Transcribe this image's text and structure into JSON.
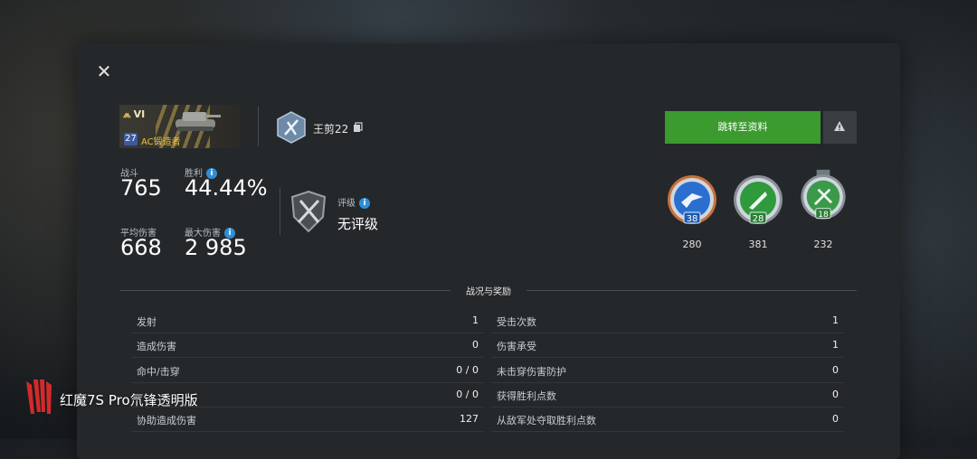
{
  "vehicle": {
    "tier": "VI",
    "level": "27",
    "name": "AC锻造者"
  },
  "player": {
    "name": "王剪22"
  },
  "stats": {
    "battles_label": "战斗",
    "battles_value": "765",
    "win_label": "胜利",
    "win_value": "44.44%",
    "avg_dmg_label": "平均伤害",
    "avg_dmg_value": "668",
    "max_dmg_label": "最大伤害",
    "max_dmg_value": "2 985"
  },
  "rating": {
    "label": "评级",
    "value": "无评级"
  },
  "actions": {
    "goto_profile": "跳转至资料"
  },
  "medals": [
    {
      "badge": "38",
      "count": "280",
      "color": "#2a6fd0"
    },
    {
      "badge": "28",
      "count": "381",
      "color": "#2f9a3c"
    },
    {
      "badge": "18",
      "count": "232",
      "color": "#3a9a4a"
    }
  ],
  "section": {
    "title": "战况与奖励"
  },
  "left_rows": [
    {
      "label": "发射",
      "value": "1"
    },
    {
      "label": "造成伤害",
      "value": "0"
    },
    {
      "label": "命中/击穿",
      "value": "0 / 0"
    },
    {
      "label": "",
      "value": "0 / 0"
    },
    {
      "label": "协助造成伤害",
      "value": "127"
    }
  ],
  "right_rows": [
    {
      "label": "受击次数",
      "value": "1"
    },
    {
      "label": "伤害承受",
      "value": "1"
    },
    {
      "label": "未击穿伤害防护",
      "value": "0"
    },
    {
      "label": "获得胜利点数",
      "value": "0"
    },
    {
      "label": "从敌军处夺取胜利点数",
      "value": "0"
    }
  ],
  "watermark": {
    "text": "红魔7S Pro氘锋透明版"
  }
}
